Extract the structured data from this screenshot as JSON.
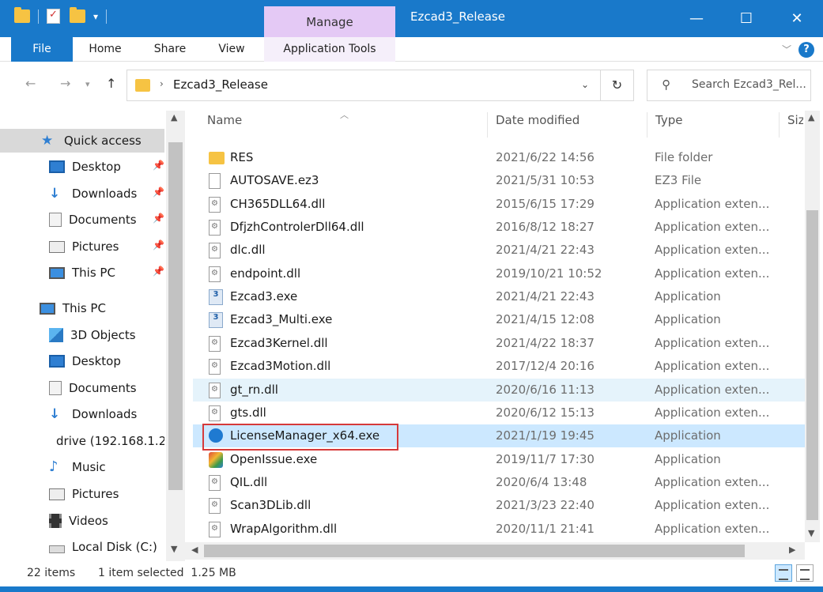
{
  "window": {
    "title": "Ezcad3_Release",
    "contextual_tab": "Manage",
    "minimize": "—",
    "maximize": "☐",
    "close": "✕",
    "accent": "#1979ca"
  },
  "ribbon": {
    "tabs": [
      "File",
      "Home",
      "Share",
      "View",
      "Application Tools"
    ],
    "help": "?"
  },
  "address": {
    "breadcrumb": "Ezcad3_Release",
    "search_placeholder": "Search Ezcad3_Rel..."
  },
  "nav": {
    "items": [
      {
        "label": "Quick access",
        "icon": "star-icon",
        "pinned": false
      },
      {
        "label": "Desktop",
        "icon": "desktop-icon",
        "pinned": true
      },
      {
        "label": "Downloads",
        "icon": "download-icon",
        "pinned": true
      },
      {
        "label": "Documents",
        "icon": "documents-icon",
        "pinned": true
      },
      {
        "label": "Pictures",
        "icon": "pictures-icon",
        "pinned": true
      },
      {
        "label": "This PC",
        "icon": "computer-icon",
        "pinned": true
      },
      {
        "label": "This PC",
        "icon": "computer-icon",
        "pinned": false
      },
      {
        "label": "3D Objects",
        "icon": "cube-icon",
        "pinned": false
      },
      {
        "label": "Desktop",
        "icon": "desktop-icon",
        "pinned": false
      },
      {
        "label": "Documents",
        "icon": "documents-icon",
        "pinned": false
      },
      {
        "label": "Downloads",
        "icon": "download-icon",
        "pinned": false
      },
      {
        "label": "drive (192.168.1.2",
        "icon": "network-drive-icon",
        "pinned": false
      },
      {
        "label": "Music",
        "icon": "music-icon",
        "pinned": false
      },
      {
        "label": "Pictures",
        "icon": "pictures-icon",
        "pinned": false
      },
      {
        "label": "Videos",
        "icon": "videos-icon",
        "pinned": false
      },
      {
        "label": "Local Disk (C:)",
        "icon": "disk-icon",
        "pinned": false
      }
    ]
  },
  "columns": {
    "name": "Name",
    "date": "Date modified",
    "type": "Type",
    "size": "Size"
  },
  "files": [
    {
      "name": "RES",
      "date": "2021/6/22 14:56",
      "type": "File folder",
      "icon": "folder"
    },
    {
      "name": "AUTOSAVE.ez3",
      "date": "2021/5/31 10:53",
      "type": "EZ3 File",
      "icon": "file"
    },
    {
      "name": "CH365DLL64.dll",
      "date": "2015/6/15 17:29",
      "type": "Application exten...",
      "icon": "dll"
    },
    {
      "name": "DfjzhControlerDll64.dll",
      "date": "2016/8/12 18:27",
      "type": "Application exten...",
      "icon": "dll"
    },
    {
      "name": "dlc.dll",
      "date": "2021/4/21 22:43",
      "type": "Application exten...",
      "icon": "dll"
    },
    {
      "name": "endpoint.dll",
      "date": "2019/10/21 10:52",
      "type": "Application exten...",
      "icon": "dll"
    },
    {
      "name": "Ezcad3.exe",
      "date": "2021/4/21 22:43",
      "type": "Application",
      "icon": "ezcad"
    },
    {
      "name": "Ezcad3_Multi.exe",
      "date": "2021/4/15 12:08",
      "type": "Application",
      "icon": "ezcad"
    },
    {
      "name": "Ezcad3Kernel.dll",
      "date": "2021/4/22 18:37",
      "type": "Application exten...",
      "icon": "dll"
    },
    {
      "name": "Ezcad3Motion.dll",
      "date": "2017/12/4 20:16",
      "type": "Application exten...",
      "icon": "dll"
    },
    {
      "name": "gt_rn.dll",
      "date": "2020/6/16 11:13",
      "type": "Application exten...",
      "icon": "dll"
    },
    {
      "name": "gts.dll",
      "date": "2020/6/12 15:13",
      "type": "Application exten...",
      "icon": "dll"
    },
    {
      "name": "LicenseManager_x64.exe",
      "date": "2021/1/19 19:45",
      "type": "Application",
      "icon": "license"
    },
    {
      "name": "OpenIssue.exe",
      "date": "2019/11/7 17:30",
      "type": "Application",
      "icon": "openissue"
    },
    {
      "name": "QIL.dll",
      "date": "2020/6/4 13:48",
      "type": "Application exten...",
      "icon": "dll"
    },
    {
      "name": "Scan3DLib.dll",
      "date": "2021/3/23 22:40",
      "type": "Application exten...",
      "icon": "dll"
    },
    {
      "name": "WrapAlgorithm.dll",
      "date": "2020/11/1 21:41",
      "type": "Application exten...",
      "icon": "dll"
    }
  ],
  "status": {
    "count": "22 items",
    "selection": "1 item selected  1.25 MB"
  }
}
